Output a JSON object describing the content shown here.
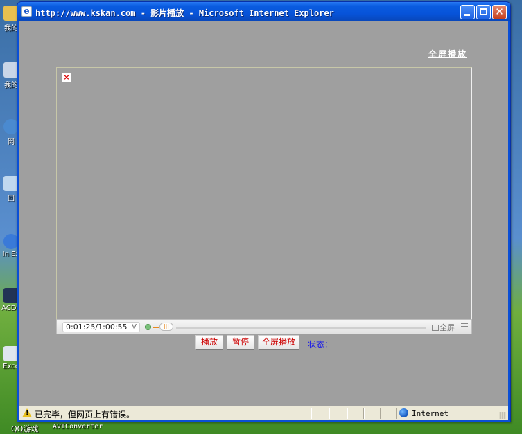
{
  "window": {
    "title": "http://www.kskan.com - 影片播放 - Microsoft Internet Explorer",
    "minimize_icon": "minimize-icon",
    "maximize_icon": "maximize-icon",
    "close_icon": "close-icon"
  },
  "desktop": {
    "icons": [
      {
        "label": "我的",
        "icon": "folder-icon",
        "color": "#e8c050"
      },
      {
        "label": "我的",
        "icon": "computer-icon",
        "color": "#c9d6e8"
      },
      {
        "label": "网",
        "icon": "network-icon",
        "color": "#4a8ad0"
      },
      {
        "label": "回",
        "icon": "recycle-bin-icon",
        "color": "#c0d8ef"
      },
      {
        "label": "In Ex",
        "icon": "ie-icon",
        "color": "#3a7ad8"
      },
      {
        "label": "ACDS",
        "icon": "acdsee-icon",
        "color": "#223355"
      },
      {
        "label": "Exce",
        "icon": "excel-icon",
        "color": "#dfe6ee"
      }
    ],
    "taskbar_items": [
      "QQ游戏",
      "AVIConverter"
    ]
  },
  "page": {
    "fullscreen_link": "全屏播放",
    "player": {
      "broken_image_glyph": "×",
      "time_display": "0:01:25/1:00:55",
      "time_dropdown": "V",
      "fullscreen_label": "全屏",
      "progress": 0.023
    },
    "buttons": {
      "play": "播放",
      "pause": "暂停",
      "fullscreen": "全屏播放"
    },
    "status_label": "状态："
  },
  "statusbar": {
    "message": "已完毕，但网页上有错误。",
    "zone": "Internet",
    "warning_icon": "warning-icon",
    "zone_icon": "globe-icon"
  },
  "colors": {
    "content_bg": "#9f9f9f",
    "button_text": "#cc0000",
    "status_text": "#1111ee",
    "titlebar": "#0753d9"
  }
}
